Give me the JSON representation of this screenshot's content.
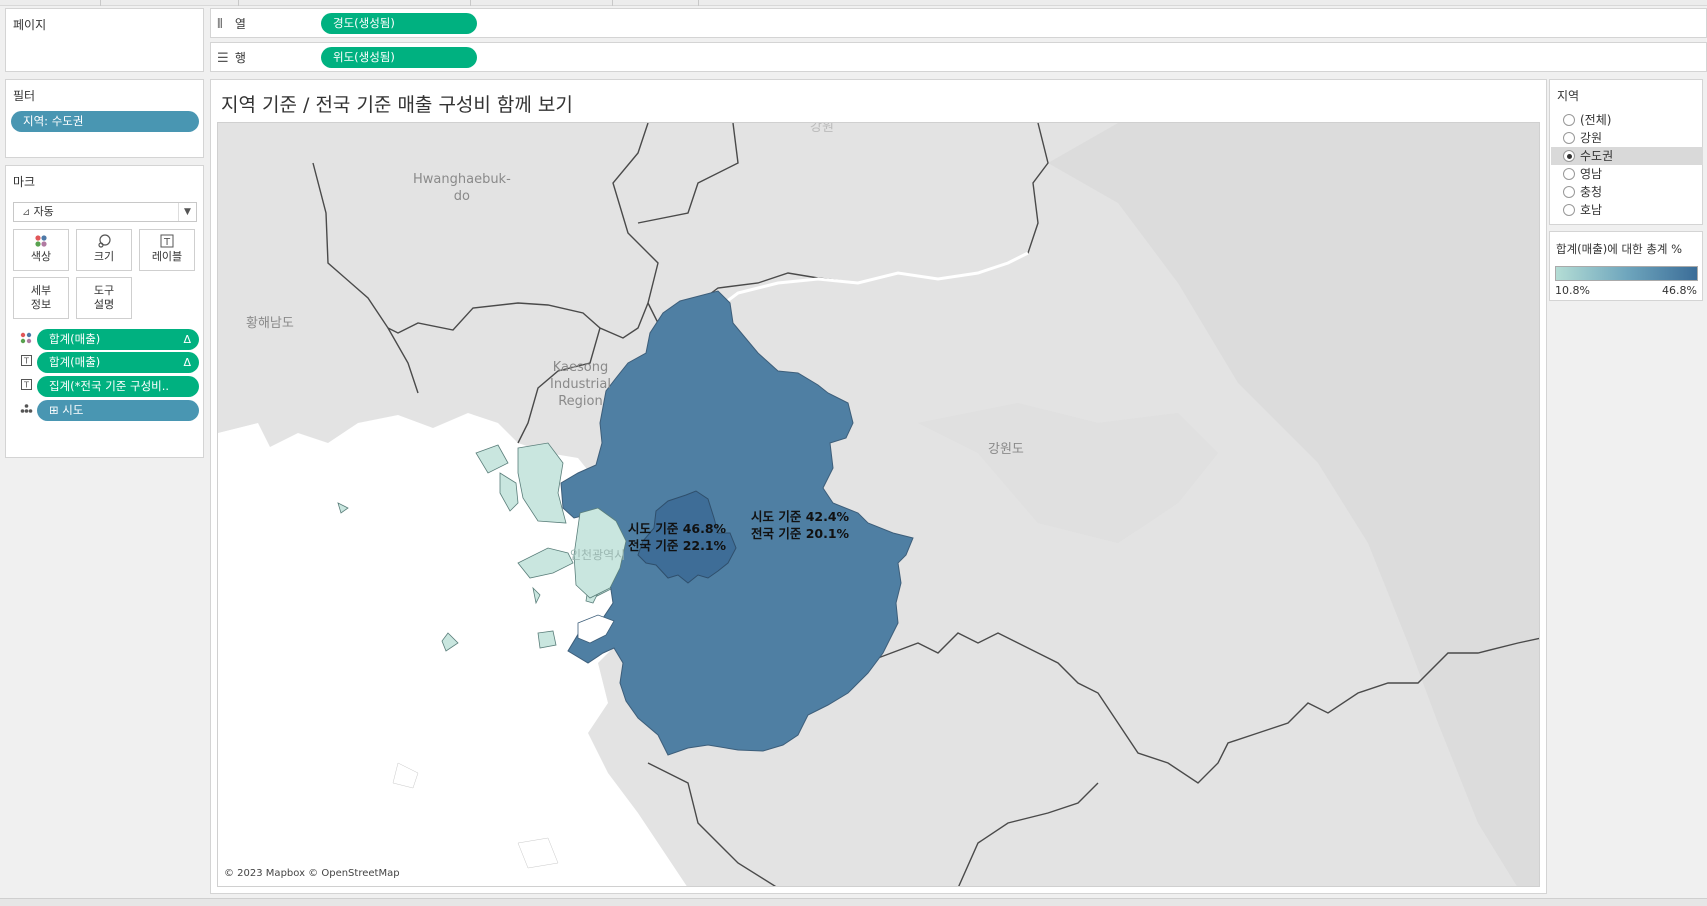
{
  "pages_panel": {
    "title": "페이지"
  },
  "shelves": {
    "columns": {
      "label": "열",
      "pill": "경도(생성됨)"
    },
    "rows": {
      "label": "행",
      "pill": "위도(생성됨)"
    }
  },
  "filters_panel": {
    "title": "필터",
    "items": [
      "지역: 수도권"
    ]
  },
  "marks_panel": {
    "title": "마크",
    "mark_type": "자동",
    "buttons": [
      {
        "label": "색상",
        "icon": "color-dots-icon"
      },
      {
        "label": "크기",
        "icon": "size-icon"
      },
      {
        "label": "레이블",
        "icon": "label-icon"
      },
      {
        "label": "세부\n정보",
        "icon": "detail-icon"
      },
      {
        "label": "도구\n설명",
        "icon": "tooltip-icon"
      }
    ],
    "fields": [
      {
        "label": "합계(매출)",
        "icon": "color-dots-icon",
        "delta": "Δ"
      },
      {
        "label": "합계(매출)",
        "icon": "text-label-icon",
        "delta": "Δ"
      },
      {
        "label": "집계(*전국 기준 구성비..",
        "icon": "text-label-icon",
        "delta": ""
      },
      {
        "label": "시도",
        "icon": "detail-icon",
        "delta": "",
        "expand": "⊞"
      }
    ]
  },
  "view": {
    "title": "지역 기준 / 전국 기준 매출 구성비 함께 보기",
    "attribution": "© 2023 Mapbox © OpenStreetMap",
    "map_labels": {
      "hwanghaebuk": "Hwanghaebuk-\ndo",
      "hwanghaenam": "황해남도",
      "kaesong": "Kaesong\nIndustrial\nRegion",
      "gangwon": "강원도",
      "incheon_faint": "인천광역시",
      "top_faint": "강원"
    },
    "annotations": {
      "seoul": {
        "line1": "시도 기준 46.8%",
        "line2": "전국 기준 22.1%"
      },
      "gyeonggi": {
        "line1": "시도 기준 42.4%",
        "line2": "전국 기준 20.1%"
      }
    },
    "colors": {
      "seoul": "#3e6d97",
      "gyeonggi": "#4f7fa3",
      "incheon": "#c9e6df",
      "land": "#e3e3e3",
      "water": "#ffffff",
      "border": "#4a4a4a"
    }
  },
  "region_filter": {
    "title": "지역",
    "options": [
      "(전체)",
      "강원",
      "수도권",
      "영남",
      "충청",
      "호남"
    ],
    "selected": "수도권"
  },
  "legend": {
    "title": "합계(매출)에 대한 총계 %",
    "min": "10.8%",
    "max": "46.8%",
    "color_min": "#b4ddd5",
    "color_max": "#3b6d98"
  }
}
